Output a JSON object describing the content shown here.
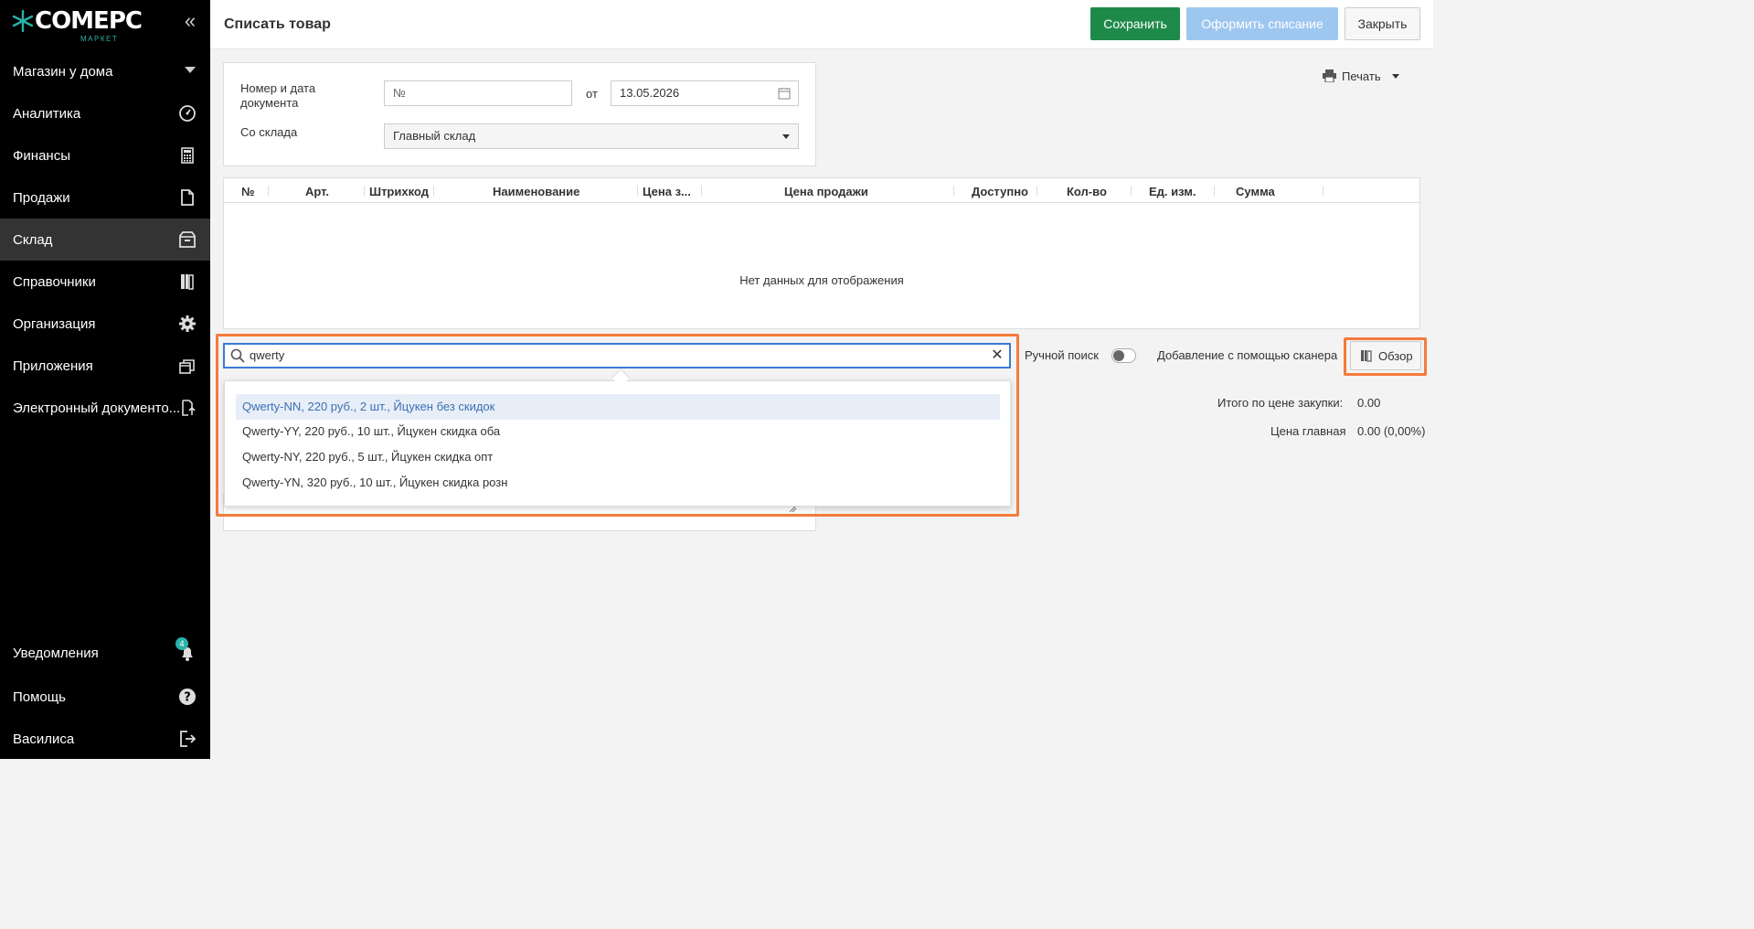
{
  "sidebar": {
    "logo": {
      "text": "СОМЕРС",
      "sub": "МАРКЕТ"
    },
    "store": "Магазин у дома",
    "items": [
      {
        "label": "Аналитика",
        "icon": "gauge-icon"
      },
      {
        "label": "Финансы",
        "icon": "calculator-icon"
      },
      {
        "label": "Продажи",
        "icon": "document-icon"
      },
      {
        "label": "Склад",
        "icon": "box-icon",
        "active": true
      },
      {
        "label": "Справочники",
        "icon": "books-icon"
      },
      {
        "label": "Организация",
        "icon": "gear-icon"
      },
      {
        "label": "Приложения",
        "icon": "windows-icon"
      },
      {
        "label": "Электронный документо...",
        "icon": "edoc-icon"
      }
    ],
    "bottom": [
      {
        "label": "Уведомления",
        "icon": "bell-icon",
        "badge": "4"
      },
      {
        "label": "Помощь",
        "icon": "help-icon"
      },
      {
        "label": "Василиса",
        "icon": "logout-icon"
      }
    ]
  },
  "header": {
    "title": "Списать товар",
    "save": "Сохранить",
    "writeoff": "Оформить списание",
    "close": "Закрыть"
  },
  "form": {
    "doc_label": "Номер и дата документа",
    "doc_placeholder": "№",
    "from_label": "от",
    "date": "13.05.2026",
    "warehouse_label": "Со склада",
    "warehouse": "Главный склад"
  },
  "print": "Печать",
  "grid": {
    "columns": [
      "№",
      "Арт.",
      "Штрихкод",
      "Наименование",
      "Цена з...",
      "Цена продажи",
      "Доступно",
      "Кол-во",
      "Ед. изм.",
      "Сумма"
    ],
    "empty": "Нет данных для отображения"
  },
  "search": {
    "value": "qwerty",
    "results": [
      "Qwerty-NN, 220 руб., 2 шт., Йцукен без скидок",
      "Qwerty-YY, 220 руб., 10 шт., Йцукен скидка оба",
      "Qwerty-NY, 220 руб., 5 шт., Йцукен скидка опт",
      "Qwerty-YN, 320 руб., 10 шт., Йцукен скидка розн"
    ]
  },
  "manual_search": "Ручной поиск",
  "scanner": "Добавление с помощью сканера",
  "browse": "Обзор",
  "totals": {
    "purchase_label": "Итого по цене закупки:",
    "purchase_value": "0.00",
    "main_label": "Цена главная",
    "main_value": "0.00 (0,00%)"
  },
  "colors": {
    "accent": "#1e8a4a",
    "brand_teal": "#2bb1a8",
    "highlight": "#f47b3b",
    "disabled_blue": "#9ec7f0"
  }
}
